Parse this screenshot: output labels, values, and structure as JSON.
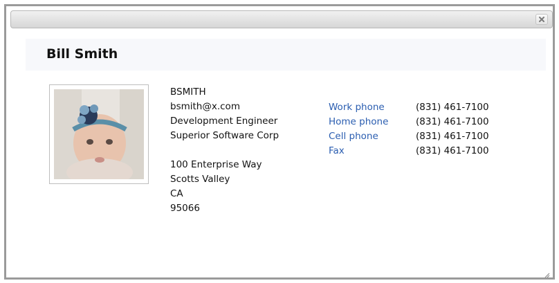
{
  "contact": {
    "name": "Bill Smith",
    "username": "BSMITH",
    "email": "bsmith@x.com",
    "title": "Development Engineer",
    "company": "Superior Software Corp",
    "address": {
      "street": "100 Enterprise Way",
      "city": "Scotts Valley",
      "state": "CA",
      "zip": "95066"
    },
    "phones": [
      {
        "label": "Work phone",
        "value": "(831) 461-7100"
      },
      {
        "label": "Home phone",
        "value": "(831) 461-7100"
      },
      {
        "label": "Cell phone",
        "value": "(831) 461-7100"
      },
      {
        "label": "Fax",
        "value": "(831) 461-7100"
      }
    ]
  },
  "icons": {
    "close": "close-icon",
    "resize": "resize-grip-icon",
    "photo": "contact-photo"
  },
  "colors": {
    "link": "#2a5db0",
    "titlebar_top": "#f1f1f1",
    "titlebar_bottom": "#d6d6d6",
    "header_band": "#f7f8fb"
  }
}
